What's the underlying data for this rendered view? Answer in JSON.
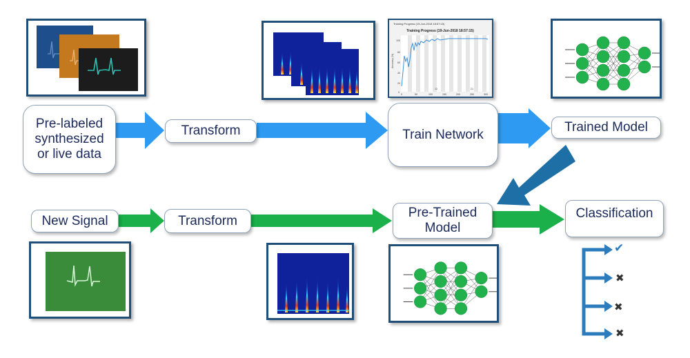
{
  "diagram": {
    "top_row": {
      "source": "Pre-labeled synthesized or live data",
      "source_lines": [
        "Pre-labeled",
        "synthesized",
        "or live data"
      ],
      "transform": "Transform",
      "train": "Train Network",
      "trained_model": "Trained Model"
    },
    "bottom_row": {
      "new_signal": "New Signal",
      "transform": "Transform",
      "pretrained_lines": [
        "Pre-Trained",
        "Model"
      ],
      "classification": "Classification"
    },
    "training_plot": {
      "window_title": "Training Progress (19-Jun-2018 18:57:15)",
      "title": "Training Progress (19-Jun-2018 18:57:15)",
      "ylabel": "Accuracy (%)",
      "y_ticks": [
        "0",
        "20",
        "40",
        "60",
        "80",
        "100"
      ],
      "x_ticks": [
        "0",
        "50",
        "100",
        "150",
        "200",
        "250",
        "300"
      ],
      "epoch_labels": [
        "12",
        "21"
      ]
    },
    "classification_results": [
      {
        "icon": "check-icon",
        "glyph": "✔"
      },
      {
        "icon": "x-icon",
        "glyph": "✖"
      },
      {
        "icon": "x-icon",
        "glyph": "✖"
      },
      {
        "icon": "x-icon",
        "glyph": "✖"
      }
    ],
    "colors": {
      "top_arrow": "#2e9af2",
      "bottom_arrow": "#1bb04a",
      "link_arrow": "#1d6fa5",
      "thumb_border": "#1f4e79",
      "text": "#1b2a5a",
      "neuron": "#22b14c"
    }
  }
}
